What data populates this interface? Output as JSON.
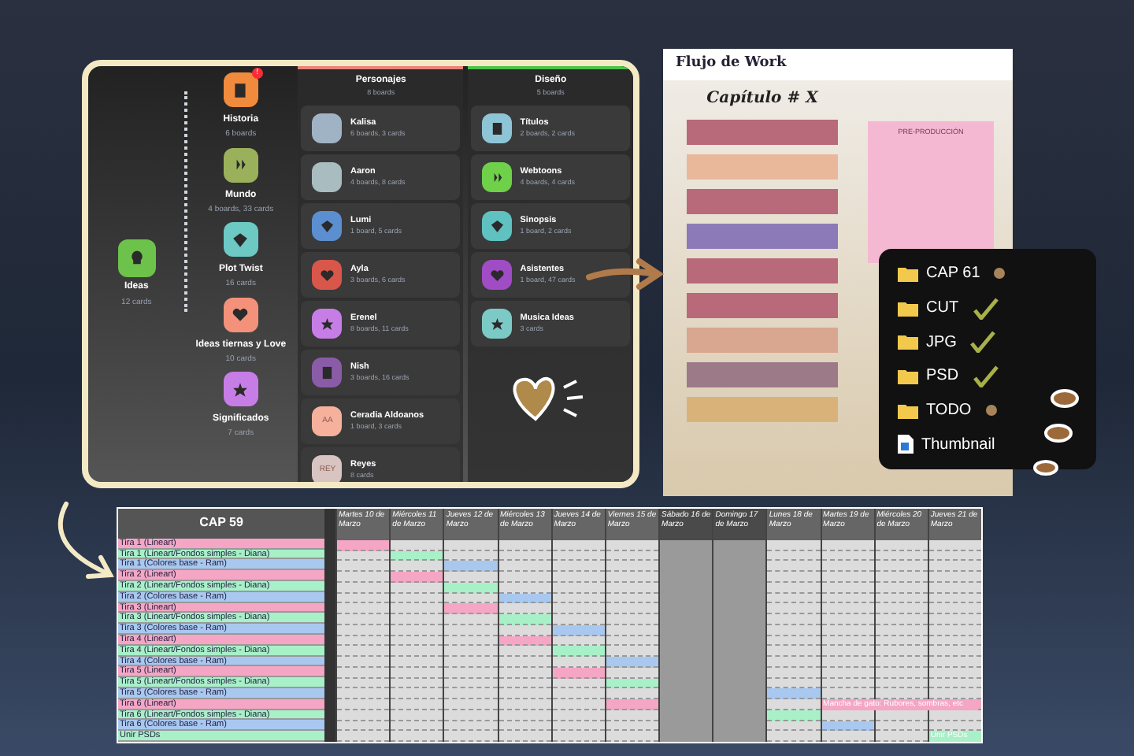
{
  "boards_panel": {
    "root": {
      "title": "Ideas",
      "count": "12 cards",
      "color": "#6cc24a"
    },
    "categories": [
      {
        "title": "Historia",
        "count": "6 boards",
        "color": "#f08a3c",
        "badge": "!"
      },
      {
        "title": "Mundo",
        "count": "4 boards, 33 cards",
        "color": "#9bb05a"
      },
      {
        "title": "Plot Twist",
        "count": "16 cards",
        "color": "#6cc9c4"
      },
      {
        "title": "Ideas tiernas y Love",
        "count": "10 cards",
        "color": "#f4917a"
      },
      {
        "title": "Significados",
        "count": "7 cards",
        "color": "#c77de6"
      }
    ],
    "columns": [
      {
        "title": "Personajes",
        "count": "8 boards",
        "color": "#e8837a",
        "items": [
          {
            "title": "Kalisa",
            "count": "6 boards, 3 cards",
            "kind": "photo",
            "color": "#9fb3c4"
          },
          {
            "title": "Aaron",
            "count": "4 boards, 8 cards",
            "kind": "photo",
            "color": "#a9bcc0"
          },
          {
            "title": "Lumi",
            "count": "1 board, 5 cards",
            "kind": "icon",
            "color": "#5b8fcf"
          },
          {
            "title": "Ayla",
            "count": "3 boards, 6 cards",
            "kind": "icon",
            "color": "#d9574a"
          },
          {
            "title": "Erenel",
            "count": "8 boards, 11 cards",
            "kind": "icon",
            "color": "#c77de6"
          },
          {
            "title": "Nish",
            "count": "3 boards, 16 cards",
            "kind": "icon",
            "color": "#8a5ca8"
          },
          {
            "title": "Ceradia Aldoanos",
            "count": "1 board, 3 cards",
            "kind": "initials",
            "initials": "AA",
            "color": "#f5b19c"
          },
          {
            "title": "Reyes",
            "count": "8 cards",
            "kind": "initials",
            "initials": "REY",
            "color": "#d8c4c0"
          }
        ]
      },
      {
        "title": "Diseño",
        "count": "5 boards",
        "color": "#4cc24a",
        "items": [
          {
            "title": "Títulos",
            "count": "2 boards, 2 cards",
            "kind": "icon",
            "color": "#8ec5d6"
          },
          {
            "title": "Webtoons",
            "count": "4 boards, 4 cards",
            "kind": "icon",
            "color": "#6fd04a"
          },
          {
            "title": "Sinopsis",
            "count": "1 board, 2 cards",
            "kind": "icon",
            "color": "#5fc2c0"
          },
          {
            "title": "Asistentes",
            "count": "1 board, 47 cards",
            "kind": "icon",
            "color": "#a04cc4"
          },
          {
            "title": "Musica Ideas",
            "count": "3 cards",
            "kind": "icon",
            "color": "#7ccac6"
          }
        ]
      }
    ]
  },
  "flow": {
    "title": "Flujo de Work",
    "heading": "Capítulo # X",
    "side_title": "PRE-PRODUCCIÓN",
    "steps": [
      {
        "color": "#b8697a"
      },
      {
        "color": "#e9b89a"
      },
      {
        "color": "#b8697a"
      },
      {
        "color": "#8c7ab8"
      },
      {
        "color": "#b8697a"
      },
      {
        "color": "#b8697a"
      },
      {
        "color": "#d9a68f"
      },
      {
        "color": "#9c7a88"
      },
      {
        "color": "#d9b27a"
      }
    ]
  },
  "folders": [
    {
      "name": "CAP 61",
      "kind": "folder",
      "checked": false,
      "flagged": true
    },
    {
      "name": "CUT",
      "kind": "folder",
      "checked": true,
      "flagged": false
    },
    {
      "name": "JPG",
      "kind": "folder",
      "checked": true,
      "flagged": false
    },
    {
      "name": "PSD",
      "kind": "folder",
      "checked": true,
      "flagged": false
    },
    {
      "name": "TODO",
      "kind": "folder",
      "checked": false,
      "flagged": true
    },
    {
      "name": "Thumbnail",
      "kind": "file",
      "checked": false,
      "flagged": false
    }
  ],
  "schedule": {
    "title": "CAP 59",
    "days": [
      {
        "label": "Martes 10 de Marzo",
        "weekend": false
      },
      {
        "label": "Miércoles 11 de Marzo",
        "weekend": false
      },
      {
        "label": "Jueves 12 de Marzo",
        "weekend": false
      },
      {
        "label": "Miércoles 13 de Marzo",
        "weekend": false
      },
      {
        "label": "Jueves 14 de Marzo",
        "weekend": false
      },
      {
        "label": "Viernes 15 de Marzo",
        "weekend": false
      },
      {
        "label": "Sábado 16 de Marzo",
        "weekend": true
      },
      {
        "label": "Domingo 17 de Marzo",
        "weekend": true
      },
      {
        "label": "Lunes 18 de Marzo",
        "weekend": false
      },
      {
        "label": "Martes 19 de Marzo",
        "weekend": false
      },
      {
        "label": "Miércoles 20 de Marzo",
        "weekend": false
      },
      {
        "label": "Jueves 21 de Marzo",
        "weekend": false
      }
    ],
    "rows": [
      {
        "label": "Tira 1 (Lineart)",
        "color": "#f4a6c4",
        "cells": [
          {
            "filled": true
          },
          {
            "filled": false
          },
          {
            "filled": false
          },
          {
            "filled": false
          },
          {
            "filled": false
          },
          {
            "filled": false
          },
          {
            "filled": false
          },
          {
            "filled": false
          },
          {
            "filled": false
          },
          {
            "filled": false
          },
          {
            "filled": false
          },
          {
            "filled": false
          }
        ]
      },
      {
        "label": "Tira 1 (Lineart/Fondos simples - Diana)",
        "color": "#a8f0c8",
        "cells": [
          {
            "filled": false
          },
          {
            "filled": true
          },
          {
            "filled": false
          },
          {
            "filled": false
          },
          {
            "filled": false
          },
          {
            "filled": false
          },
          {
            "filled": false
          },
          {
            "filled": false
          },
          {
            "filled": false
          },
          {
            "filled": false
          },
          {
            "filled": false
          },
          {
            "filled": false
          }
        ]
      },
      {
        "label": "Tira 1 (Colores base - Ram)",
        "color": "#a8c8f0",
        "cells": [
          {
            "filled": false
          },
          {
            "filled": false
          },
          {
            "filled": true
          },
          {
            "filled": false
          },
          {
            "filled": false
          },
          {
            "filled": false
          },
          {
            "filled": false
          },
          {
            "filled": false
          },
          {
            "filled": false
          },
          {
            "filled": false
          },
          {
            "filled": false
          },
          {
            "filled": false
          }
        ]
      },
      {
        "label": "Tira 2 (Lineart)",
        "color": "#f4a6c4",
        "cells": [
          {
            "filled": false
          },
          {
            "filled": true
          },
          {
            "filled": false
          },
          {
            "filled": false
          },
          {
            "filled": false
          },
          {
            "filled": false
          },
          {
            "filled": false
          },
          {
            "filled": false
          },
          {
            "filled": false
          },
          {
            "filled": false
          },
          {
            "filled": false
          },
          {
            "filled": false
          }
        ]
      },
      {
        "label": "Tira 2 (Lineart/Fondos simples - Diana)",
        "color": "#a8f0c8",
        "cells": [
          {
            "filled": false
          },
          {
            "filled": false
          },
          {
            "filled": true
          },
          {
            "filled": false
          },
          {
            "filled": false
          },
          {
            "filled": false
          },
          {
            "filled": false
          },
          {
            "filled": false
          },
          {
            "filled": false
          },
          {
            "filled": false
          },
          {
            "filled": false
          },
          {
            "filled": false
          }
        ]
      },
      {
        "label": "Tira 2 (Colores base - Ram)",
        "color": "#a8c8f0",
        "cells": [
          {
            "filled": false
          },
          {
            "filled": false
          },
          {
            "filled": false
          },
          {
            "filled": true
          },
          {
            "filled": false
          },
          {
            "filled": false
          },
          {
            "filled": false
          },
          {
            "filled": false
          },
          {
            "filled": false
          },
          {
            "filled": false
          },
          {
            "filled": false
          },
          {
            "filled": false
          }
        ]
      },
      {
        "label": "Tira 3 (Lineart)",
        "color": "#f4a6c4",
        "cells": [
          {
            "filled": false
          },
          {
            "filled": false
          },
          {
            "filled": true
          },
          {
            "filled": false
          },
          {
            "filled": false
          },
          {
            "filled": false
          },
          {
            "filled": false
          },
          {
            "filled": false
          },
          {
            "filled": false
          },
          {
            "filled": false
          },
          {
            "filled": false
          },
          {
            "filled": false
          }
        ]
      },
      {
        "label": "Tira 3 (Lineart/Fondos simples - Diana)",
        "color": "#a8f0c8",
        "cells": [
          {
            "filled": false
          },
          {
            "filled": false
          },
          {
            "filled": false
          },
          {
            "filled": true
          },
          {
            "filled": false
          },
          {
            "filled": false
          },
          {
            "filled": false
          },
          {
            "filled": false
          },
          {
            "filled": false
          },
          {
            "filled": false
          },
          {
            "filled": false
          },
          {
            "filled": false
          }
        ]
      },
      {
        "label": "Tira 3 (Colores base - Ram)",
        "color": "#a8c8f0",
        "cells": [
          {
            "filled": false
          },
          {
            "filled": false
          },
          {
            "filled": false
          },
          {
            "filled": false
          },
          {
            "filled": true
          },
          {
            "filled": false
          },
          {
            "filled": false
          },
          {
            "filled": false
          },
          {
            "filled": false
          },
          {
            "filled": false
          },
          {
            "filled": false
          },
          {
            "filled": false
          }
        ]
      },
      {
        "label": "Tira 4 (Lineart)",
        "color": "#f4a6c4",
        "cells": [
          {
            "filled": false
          },
          {
            "filled": false
          },
          {
            "filled": false
          },
          {
            "filled": true
          },
          {
            "filled": false
          },
          {
            "filled": false
          },
          {
            "filled": false
          },
          {
            "filled": false
          },
          {
            "filled": false
          },
          {
            "filled": false
          },
          {
            "filled": false
          },
          {
            "filled": false
          }
        ]
      },
      {
        "label": "Tira 4 (Lineart/Fondos simples - Diana)",
        "color": "#a8f0c8",
        "cells": [
          {
            "filled": false
          },
          {
            "filled": false
          },
          {
            "filled": false
          },
          {
            "filled": false
          },
          {
            "filled": true
          },
          {
            "filled": false
          },
          {
            "filled": false
          },
          {
            "filled": false
          },
          {
            "filled": false
          },
          {
            "filled": false
          },
          {
            "filled": false
          },
          {
            "filled": false
          }
        ]
      },
      {
        "label": "Tira 4 (Colores base - Ram)",
        "color": "#a8c8f0",
        "cells": [
          {
            "filled": false
          },
          {
            "filled": false
          },
          {
            "filled": false
          },
          {
            "filled": false
          },
          {
            "filled": false
          },
          {
            "filled": true
          },
          {
            "filled": false
          },
          {
            "filled": false
          },
          {
            "filled": false
          },
          {
            "filled": false
          },
          {
            "filled": false
          },
          {
            "filled": false
          }
        ]
      },
      {
        "label": "Tira 5 (Lineart)",
        "color": "#f4a6c4",
        "cells": [
          {
            "filled": false
          },
          {
            "filled": false
          },
          {
            "filled": false
          },
          {
            "filled": false
          },
          {
            "filled": true
          },
          {
            "filled": false
          },
          {
            "filled": false
          },
          {
            "filled": false
          },
          {
            "filled": false
          },
          {
            "filled": false
          },
          {
            "filled": false
          },
          {
            "filled": false
          }
        ]
      },
      {
        "label": "Tira 5 (Lineart/Fondos simples - Diana)",
        "color": "#a8f0c8",
        "cells": [
          {
            "filled": false
          },
          {
            "filled": false
          },
          {
            "filled": false
          },
          {
            "filled": false
          },
          {
            "filled": false
          },
          {
            "filled": true
          },
          {
            "filled": false
          },
          {
            "filled": false
          },
          {
            "filled": false
          },
          {
            "filled": false
          },
          {
            "filled": false
          },
          {
            "filled": false
          }
        ]
      },
      {
        "label": "Tira 5 (Colores base - Ram)",
        "color": "#a8c8f0",
        "cells": [
          {
            "filled": false
          },
          {
            "filled": false
          },
          {
            "filled": false
          },
          {
            "filled": false
          },
          {
            "filled": false
          },
          {
            "filled": false
          },
          {
            "filled": false
          },
          {
            "filled": false
          },
          {
            "filled": true
          },
          {
            "filled": false
          },
          {
            "filled": false
          },
          {
            "filled": false
          }
        ]
      },
      {
        "label": "Tira 6 (Lineart)",
        "color": "#f4a6c4",
        "cells": [
          {
            "filled": false
          },
          {
            "filled": false
          },
          {
            "filled": false
          },
          {
            "filled": false
          },
          {
            "filled": false
          },
          {
            "filled": true
          },
          {
            "filled": false
          },
          {
            "filled": false
          },
          {
            "filled": false
          },
          {
            "filled": true,
            "text": "Mancha de gato: Rubores, sombras, etc"
          },
          {
            "filled": true
          },
          {
            "filled": true
          }
        ]
      },
      {
        "label": "Tira 6 (Lineart/Fondos simples - Diana)",
        "color": "#a8f0c8",
        "cells": [
          {
            "filled": false
          },
          {
            "filled": false
          },
          {
            "filled": false
          },
          {
            "filled": false
          },
          {
            "filled": false
          },
          {
            "filled": false
          },
          {
            "filled": false
          },
          {
            "filled": false
          },
          {
            "filled": true
          },
          {
            "filled": false
          },
          {
            "filled": false
          },
          {
            "filled": false
          }
        ]
      },
      {
        "label": "Tira 6 (Colores base - Ram)",
        "color": "#a8c8f0",
        "cells": [
          {
            "filled": false
          },
          {
            "filled": false
          },
          {
            "filled": false
          },
          {
            "filled": false
          },
          {
            "filled": false
          },
          {
            "filled": false
          },
          {
            "filled": false
          },
          {
            "filled": false
          },
          {
            "filled": false
          },
          {
            "filled": true
          },
          {
            "filled": false
          },
          {
            "filled": false
          }
        ]
      },
      {
        "label": "Unir PSDs",
        "color": "#a8f0c8",
        "cells": [
          {
            "filled": false
          },
          {
            "filled": false
          },
          {
            "filled": false
          },
          {
            "filled": false
          },
          {
            "filled": false
          },
          {
            "filled": false
          },
          {
            "filled": false
          },
          {
            "filled": false
          },
          {
            "filled": false
          },
          {
            "filled": false
          },
          {
            "filled": false
          },
          {
            "filled": true,
            "text": "Unir PSDs"
          }
        ]
      }
    ]
  }
}
